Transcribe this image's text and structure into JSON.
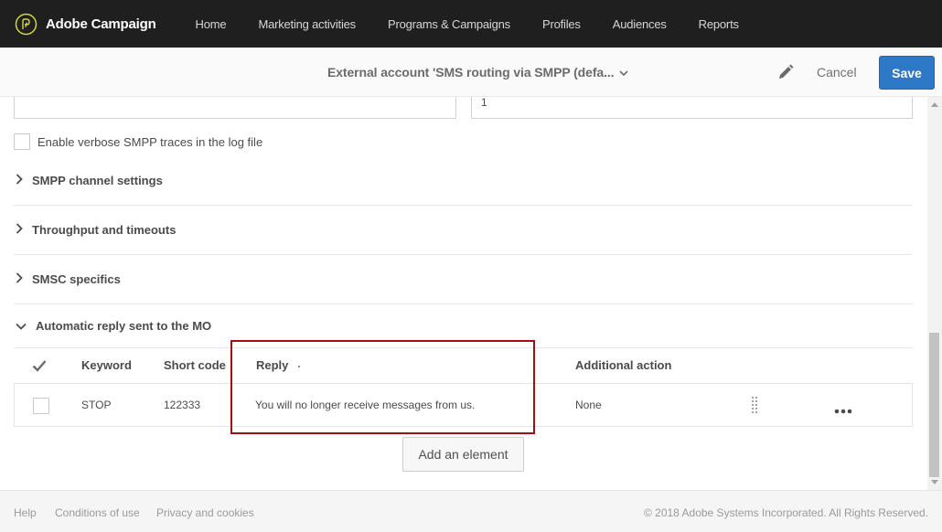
{
  "app": {
    "name": "Adobe Campaign",
    "logo_icon": "adobe-campaign-logo-icon"
  },
  "nav": {
    "items": [
      {
        "label": "Home"
      },
      {
        "label": "Marketing activities"
      },
      {
        "label": "Programs & Campaigns"
      },
      {
        "label": "Profiles"
      },
      {
        "label": "Audiences"
      },
      {
        "label": "Reports"
      }
    ]
  },
  "header": {
    "title": "External account 'SMS routing via SMPP (defa...",
    "edit_icon": "pencil-icon",
    "cancel_label": "Cancel",
    "save_label": "Save"
  },
  "form": {
    "field_left_value": "",
    "field_right_value": "1",
    "verbose_label": "Enable verbose SMPP traces in the log file",
    "verbose_checked": false
  },
  "sections": [
    {
      "label": "SMPP channel settings",
      "expanded": false
    },
    {
      "label": "Throughput and timeouts",
      "expanded": false
    },
    {
      "label": "SMSC specifics",
      "expanded": false
    },
    {
      "label": "Automatic reply sent to the MO",
      "expanded": true
    }
  ],
  "table": {
    "headers": {
      "keyword": "Keyword",
      "short_code": "Short code",
      "reply": "Reply",
      "additional_action": "Additional action"
    },
    "rows": [
      {
        "keyword": "STOP",
        "short_code": "122333",
        "reply": "You will no longer receive messages from us.",
        "additional_action": "None"
      }
    ],
    "add_label": "Add an element"
  },
  "colors": {
    "accent": "#2d79c7",
    "highlight": "#a40e12",
    "topbar": "#1f1f1f"
  },
  "footer": {
    "help": "Help",
    "conditions": "Conditions of use",
    "privacy": "Privacy and cookies",
    "copyright": "© 2018 Adobe Systems Incorporated. All Rights Reserved."
  }
}
